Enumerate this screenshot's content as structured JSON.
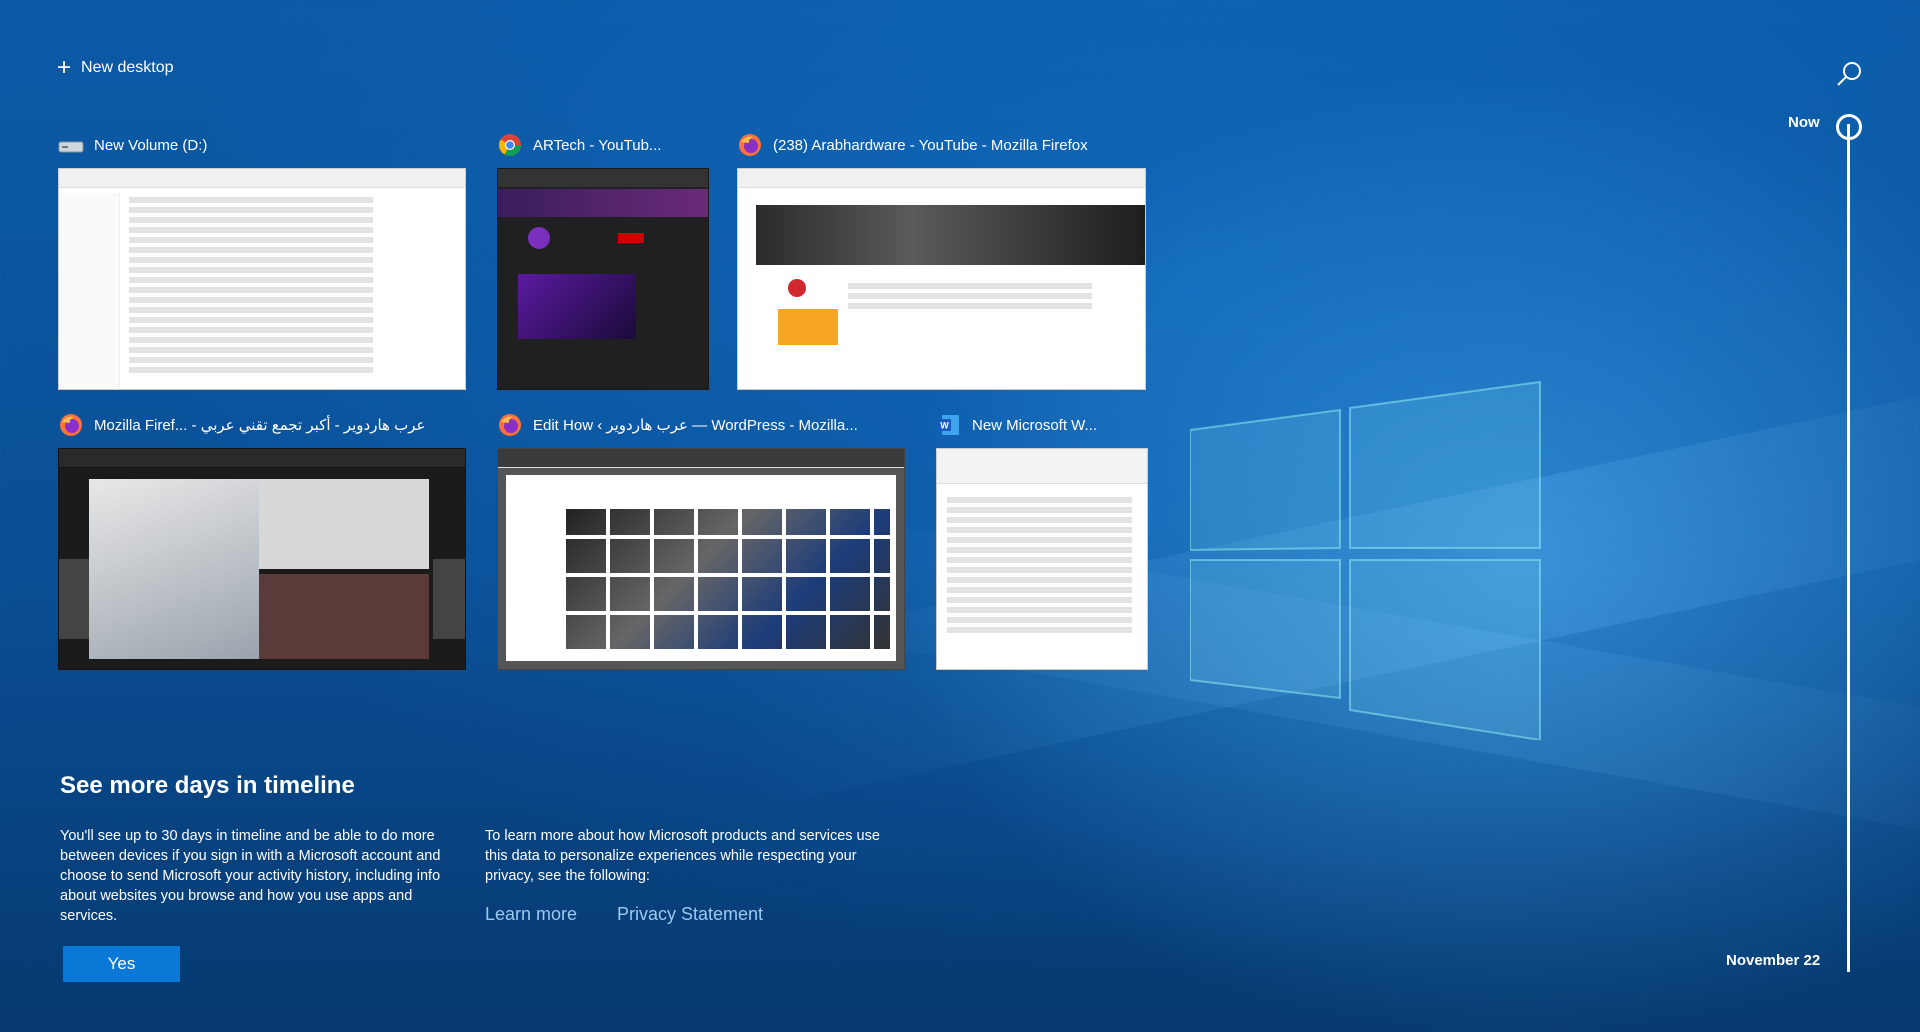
{
  "toolbar": {
    "new_desktop_label": "New desktop",
    "search_icon": "search-icon"
  },
  "cards": [
    {
      "title": "New Volume (D:)",
      "icon": "drive-icon"
    },
    {
      "title": "ARTech - YouTub...",
      "icon": "chrome-icon"
    },
    {
      "title": "(238) Arabhardware - YouTube - Mozilla Firefox",
      "icon": "firefox-icon"
    },
    {
      "title": "Mozilla Firef... - عرب هاردوير - أكبر تجمع تقني عربي",
      "icon": "firefox-icon"
    },
    {
      "title": "Edit How ‹ عرب هاردوير — WordPress - Mozilla...",
      "icon": "firefox-icon"
    },
    {
      "title": "New Microsoft W...",
      "icon": "word-icon"
    }
  ],
  "promo": {
    "heading": "See more days in timeline",
    "description": "You'll see up to 30 days in timeline and be able to do more between devices if you sign in with a Microsoft account and choose to send Microsoft your activity history, including info about websites you browse and how you use apps and services.",
    "privacy_text": "To learn more about how Microsoft products and services use this data to personalize experiences while respecting your privacy, see the following:",
    "learn_more": "Learn more",
    "privacy_statement": "Privacy Statement",
    "yes_label": "Yes"
  },
  "timeline": {
    "now_label": "Now",
    "date_label": "November 22"
  },
  "colors": {
    "accent": "#0a78d7",
    "link": "#9cc8f2",
    "background": "#0a4f96"
  }
}
